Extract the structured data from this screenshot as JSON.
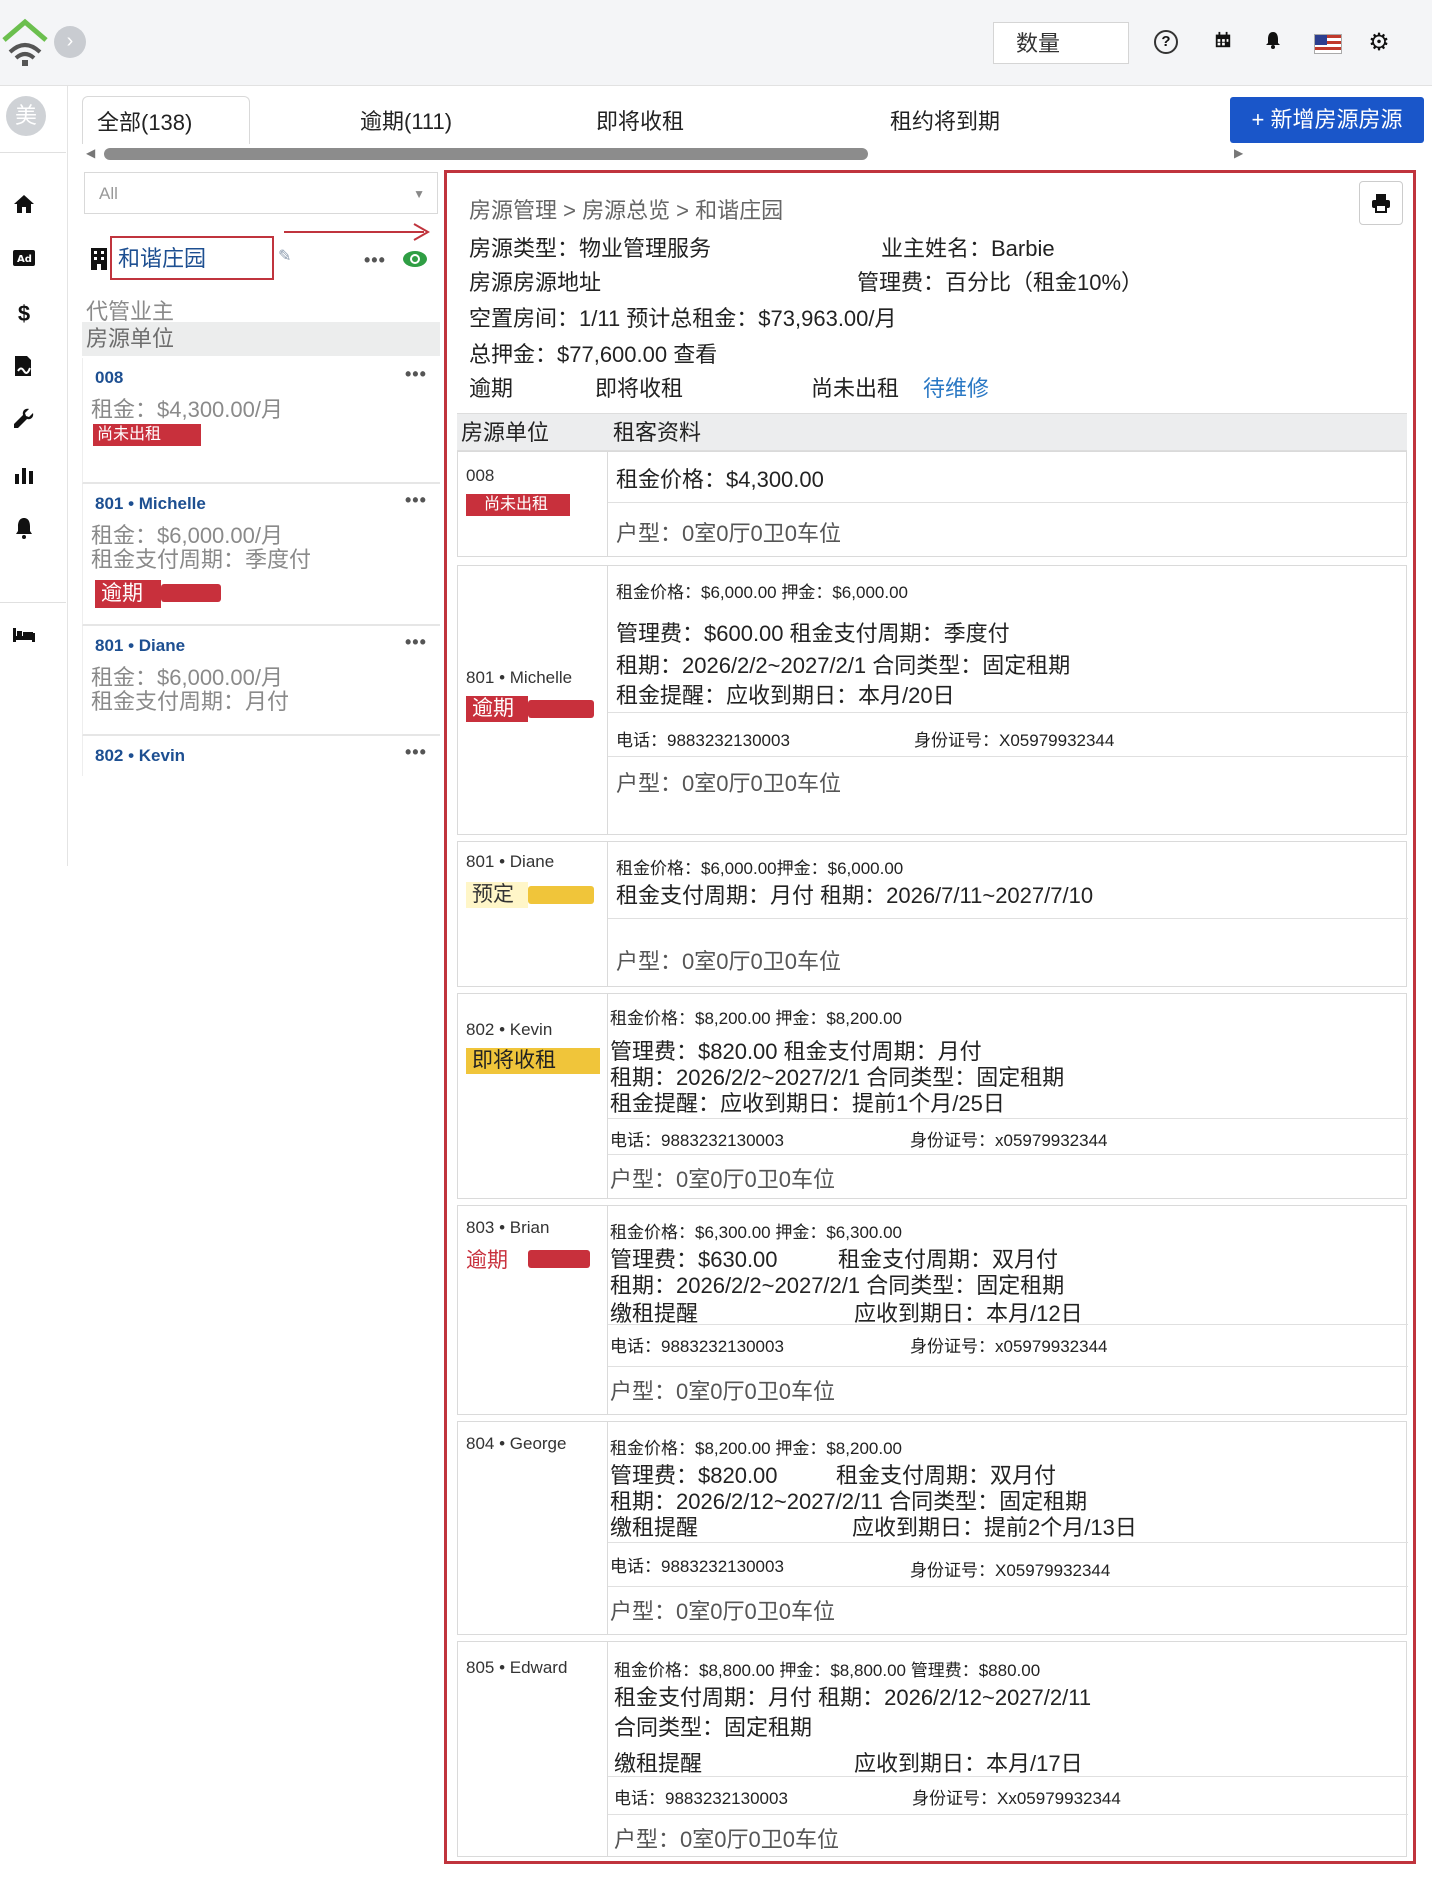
{
  "topbar": {
    "qty_label": "数量",
    "help_icon": "?"
  },
  "sidebar": {
    "avatar": "美",
    "items": [
      "home-icon",
      "ad-icon",
      "dollar-icon",
      "signature-icon",
      "wrench-icon",
      "chart-icon",
      "bell-icon",
      "bed-icon"
    ]
  },
  "tabs": [
    {
      "label": "全部(138)"
    },
    {
      "label": "逾期(111)"
    },
    {
      "label": "即将收租"
    },
    {
      "label": "租约将到期"
    }
  ],
  "add_button": "+ 新增房源房源",
  "left": {
    "filter_value": "All",
    "property_name": "和谐庄园",
    "owner_label": "代管业主",
    "units_header": "房源单位",
    "units": [
      {
        "title": "008",
        "lines": [
          "租金：$4,300.00/月"
        ],
        "badge": "尚未出租"
      },
      {
        "title": "801 • Michelle",
        "lines": [
          "租金：$6,000.00/月",
          "租金支付周期：季度付"
        ],
        "badge": "逾期"
      },
      {
        "title": "801 • Diane",
        "lines": [
          "租金：$6,000.00/月",
          "租金支付周期：月付"
        ],
        "badge": ""
      },
      {
        "title": "802 • Kevin",
        "lines": [],
        "badge": ""
      }
    ]
  },
  "detail": {
    "breadcrumb": "房源管理 > 房源总览 > 和谐庄园",
    "type_line": "房源类型：物业管理服务",
    "owner_line": "业主姓名：Barbie",
    "address_line": "房源房源地址",
    "fee_line": "管理费：百分比（租金10%）",
    "vacancy_line": "空置房间：1/11 预计总租金：$73,963.00/月",
    "deposit_line": "总押金：$77,600.00 查看",
    "filters": {
      "overdue": "逾期",
      "due_soon": "即将收租",
      "vacant": "尚未出租",
      "repair": "待维修"
    },
    "col_unit": "房源单位",
    "col_tenant": "租客资料",
    "rows": [
      {
        "unit": "008",
        "badge": "尚未出租",
        "l1": "租金价格：$4,300.00",
        "layout": "户型：0室0厅0卫0车位"
      },
      {
        "unit": "801 • Michelle",
        "badge": "逾期",
        "l1": "租金价格：$6,000.00 押金：$6,000.00",
        "l2": "管理费：$600.00 租金支付周期：季度付",
        "l3": "租期：2026/2/2~2027/2/1 合同类型：固定租期",
        "l4": "租金提醒：应收到期日：本月/20日",
        "phone": "电话：9883232130003",
        "idno": "身份证号：X05979932344",
        "layout": "户型：0室0厅0卫0车位"
      },
      {
        "unit": "801 • Diane",
        "badge": "预定",
        "l1": "租金价格：$6,000.00押金：$6,000.00",
        "l2": "租金支付周期：月付 租期：2026/7/11~2027/7/10",
        "layout": "户型：0室0厅0卫0车位"
      },
      {
        "unit": "802 • Kevin",
        "badge": "即将收租",
        "l1": "租金价格：$8,200.00 押金：$8,200.00",
        "l2": "管理费：$820.00 租金支付周期：月付",
        "l3": "租期：2026/2/2~2027/2/1 合同类型：固定租期",
        "l4": "租金提醒：应收到期日：提前1个月/25日",
        "phone": "电话：9883232130003",
        "idno": "身份证号：x05979932344",
        "layout": "户型：0室0厅0卫0车位"
      },
      {
        "unit": "803 • Brian",
        "badge": "逾期",
        "l1": "租金价格：$6,300.00 押金：$6,300.00",
        "l2a": "管理费：$630.00",
        "l2b": "租金支付周期：双月付",
        "l3": "租期：2026/2/2~2027/2/1 合同类型：固定租期",
        "l4a": "缴租提醒",
        "l4b": "应收到期日：本月/12日",
        "phone": "电话：9883232130003",
        "idno": "身份证号：x05979932344",
        "layout": "户型：0室0厅0卫0车位"
      },
      {
        "unit": "804 • George",
        "l1": "租金价格：$8,200.00 押金：$8,200.00",
        "l2a": "管理费：$820.00",
        "l2b": "租金支付周期：双月付",
        "l3": "租期：2026/2/12~2027/2/11 合同类型：固定租期",
        "l4a": "缴租提醒",
        "l4b": "应收到期日：提前2个月/13日",
        "phone": "电话：9883232130003",
        "idno": "身份证号：X05979932344",
        "layout": "户型：0室0厅0卫0车位"
      },
      {
        "unit": "805 • Edward",
        "l1": "租金价格：$8,800.00 押金：$8,800.00 管理费：$880.00",
        "l2": "租金支付周期：月付 租期：2026/2/12~2027/2/11",
        "l3": "合同类型：固定租期",
        "l4a": "缴租提醒",
        "l4b": "应收到期日：本月/17日",
        "phone": "电话：9883232130003",
        "idno": "身份证号：Xx05979932344",
        "layout": "户型：0室0厅0卫0车位"
      }
    ]
  },
  "colors": {
    "accent": "#1a56c9",
    "annotation_red": "#c0343d",
    "overdue": "#c8303c",
    "reserved": "#f0c53a",
    "link": "#2a78c4"
  }
}
